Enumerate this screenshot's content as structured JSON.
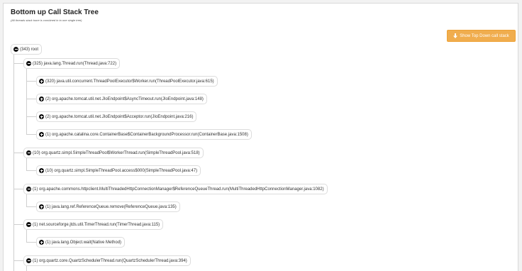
{
  "header": {
    "title": "Bottom up Call Stack Tree",
    "subtitle": "(All threads stack trace is combined in to one single tree)"
  },
  "toolbar": {
    "show_top_down_label": "Show Top Down call stack",
    "show_top_down_icon": "arrow-down-icon"
  },
  "colors": {
    "button_bg": "#f0ad4e",
    "icon": "#111111",
    "connector": "#cfcfcf"
  },
  "tree": {
    "root": {
      "label": "(343) root",
      "state": "expanded"
    },
    "nodes": [
      {
        "label": "(325) java.lang.Thread.run(Thread.java:722)",
        "state": "expanded"
      },
      {
        "label": "(320) java.util.concurrent.ThreadPoolExecutor$Worker.run(ThreadPoolExecutor.java:615)",
        "state": "collapsed"
      },
      {
        "label": "(2) org.apache.tomcat.util.net.JIoEndpoint$AsyncTimeout.run(JIoEndpoint.java:148)",
        "state": "collapsed"
      },
      {
        "label": "(2) org.apache.tomcat.util.net.JIoEndpoint$Acceptor.run(JIoEndpoint.java:216)",
        "state": "collapsed"
      },
      {
        "label": "(1) org.apache.catalina.core.ContainerBase$ContainerBackgroundProcessor.run(ContainerBase.java:1508)",
        "state": "collapsed"
      },
      {
        "label": "(10) org.quartz.simpl.SimpleThreadPool$WorkerThread.run(SimpleThreadPool.java:518)",
        "state": "expanded"
      },
      {
        "label": "(10) org.quartz.simpl.SimpleThreadPool.access$000(SimpleThreadPool.java:47)",
        "state": "collapsed"
      },
      {
        "label": "(1) org.apache.commons.httpclient.MultiThreadedHttpConnectionManager$ReferenceQueueThread.run(MultiThreadedHttpConnectionManager.java:1082)",
        "state": "expanded"
      },
      {
        "label": "(1) java.lang.ref.ReferenceQueue.remove(ReferenceQueue.java:135)",
        "state": "collapsed"
      },
      {
        "label": "(1) net.sourceforge.jtds.util.TimerThread.run(TimerThread.java:115)",
        "state": "expanded"
      },
      {
        "label": "(1) java.lang.Object.wait(Native Method)",
        "state": "collapsed"
      },
      {
        "label": "(1) org.quartz.core.QuartzSchedulerThread.run(QuartzSchedulerThread.java:394)",
        "state": "expanded"
      }
    ]
  }
}
